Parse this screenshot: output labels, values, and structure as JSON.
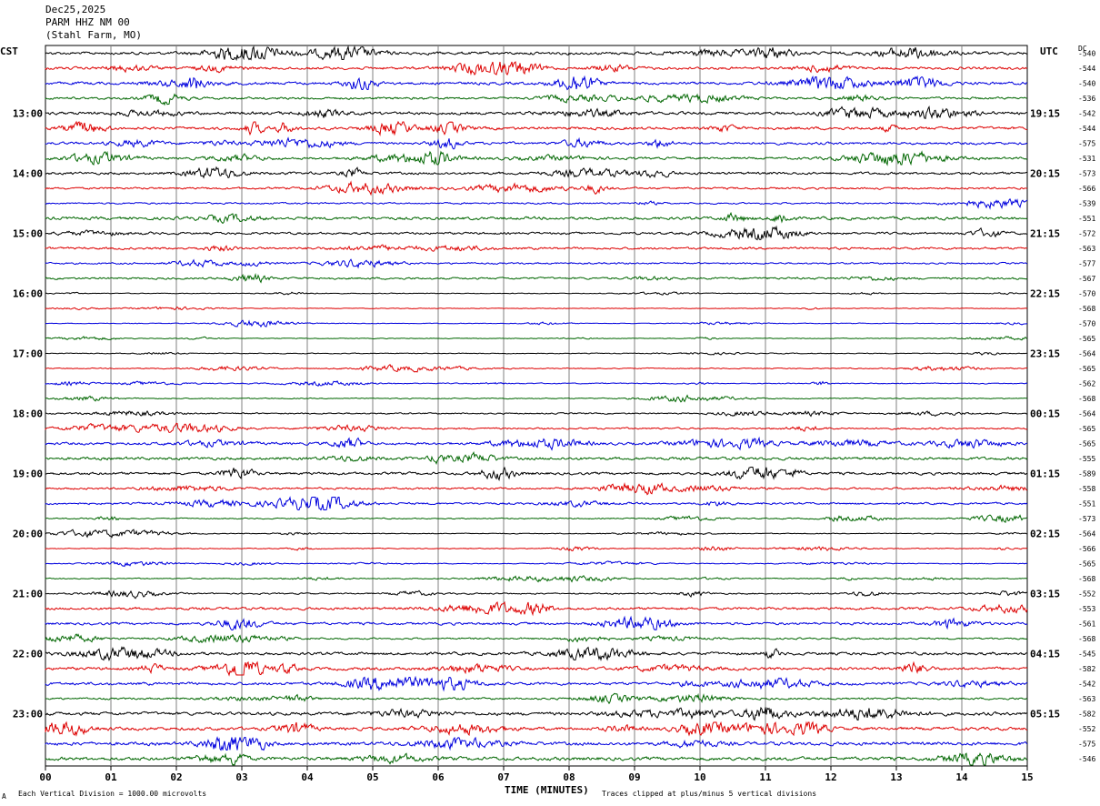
{
  "header": {
    "date": "Dec25,2025",
    "station": "PARM HHZ NM 00",
    "location": "(Stahl Farm, MO)"
  },
  "axis": {
    "left_tz": "CST",
    "right_tz": "UTC",
    "dc_label": "DC",
    "xlabel": "TIME (MINUTES)",
    "footer_left": "Each Vertical Division = 1000.00 microvolts",
    "footer_right": "Traces clipped at plus/minus 5 vertical divisions",
    "footer_mark": "A"
  },
  "chart_data": {
    "type": "line",
    "title": "",
    "xlabel": "TIME (MINUTES)",
    "x_ticks": [
      "00",
      "01",
      "02",
      "03",
      "04",
      "05",
      "06",
      "07",
      "08",
      "09",
      "10",
      "11",
      "12",
      "13",
      "14",
      "15"
    ],
    "xlim": [
      0,
      15
    ],
    "grid": true,
    "trace_colors": [
      "#000000",
      "#dd0000",
      "#0000dd",
      "#006600"
    ],
    "hour_labels_cst": [
      "13:00",
      "14:00",
      "15:00",
      "16:00",
      "17:00",
      "18:00",
      "19:00",
      "20:00",
      "21:00",
      "22:00",
      "23:00"
    ],
    "hour_labels_utc": [
      "19:15",
      "20:15",
      "21:15",
      "22:15",
      "23:15",
      "00:15",
      "01:15",
      "02:15",
      "03:15",
      "04:15",
      "05:15"
    ],
    "dc_offsets": [
      -540,
      -544,
      -540,
      -536,
      -542,
      -544,
      -575,
      -531,
      -573,
      -566,
      -539,
      -551,
      -572,
      -563,
      -577,
      -567,
      -570,
      -568,
      -570,
      -565,
      -564,
      -565,
      -562,
      -568,
      -564,
      -565,
      -565,
      -555,
      -589,
      -558,
      -551,
      -573,
      -564,
      -566,
      -565,
      -568,
      -552,
      -553,
      -561,
      -568,
      -545,
      -582,
      -542,
      -563,
      -582,
      -552,
      -575,
      -546
    ],
    "trace_activity": [
      1.0,
      0.9,
      1.0,
      0.8,
      1.0,
      1.0,
      0.9,
      0.8,
      0.9,
      0.7,
      0.6,
      1.0,
      0.8,
      0.8,
      0.6,
      0.7,
      0.25,
      0.25,
      0.25,
      0.25,
      0.3,
      0.35,
      0.35,
      0.35,
      0.5,
      0.6,
      0.9,
      1.0,
      0.9,
      0.7,
      0.7,
      0.4,
      0.3,
      0.3,
      0.3,
      0.35,
      0.5,
      0.9,
      0.9,
      0.6,
      1.0,
      1.0,
      1.0,
      0.7,
      1.1,
      1.1,
      1.2,
      1.2
    ]
  }
}
